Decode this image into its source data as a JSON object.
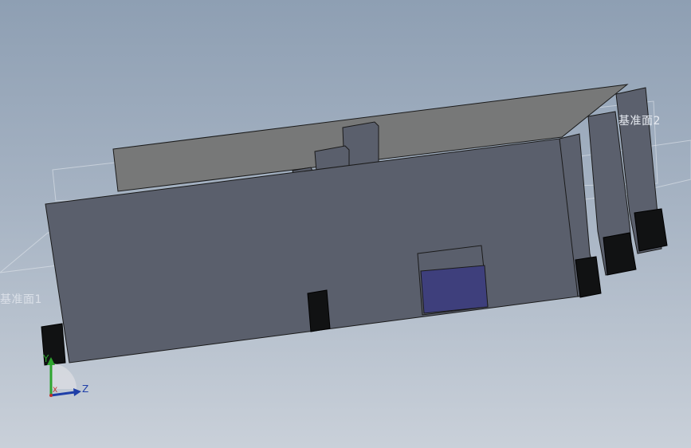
{
  "viewport": {
    "background_top": "#8e9fb3",
    "background_bottom": "#c9d0d9"
  },
  "planes": {
    "plane1_label": "基准面1",
    "plane2_label": "基准面2"
  },
  "triad": {
    "y_label": "Y",
    "x_label": "X",
    "z_label": "Z",
    "y_color": "#2fa52f",
    "x_color": "#c0302a",
    "z_color": "#1f3fa8"
  },
  "colors": {
    "body_front": "#5a5f6c",
    "body_back": "#6f7177",
    "top_face": "#7a7b7c",
    "connector_black": "#111213",
    "window_blue": "#3e3f7c"
  }
}
